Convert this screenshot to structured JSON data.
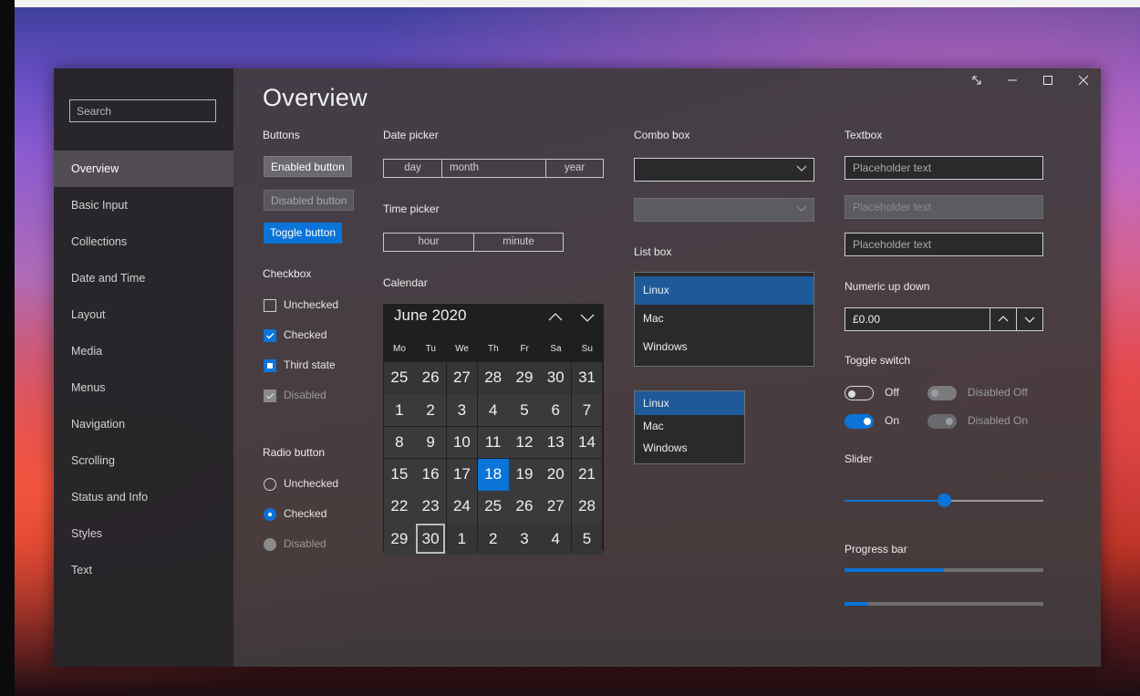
{
  "colors": {
    "accent": "#0a74d8",
    "window_bg": "#403c3e",
    "sidebar_bg": "#262428"
  },
  "search": {
    "placeholder": "Search"
  },
  "sidebar": {
    "items": [
      {
        "label": "Overview",
        "active": true
      },
      {
        "label": "Basic Input"
      },
      {
        "label": "Collections"
      },
      {
        "label": "Date and Time"
      },
      {
        "label": "Layout"
      },
      {
        "label": "Media"
      },
      {
        "label": "Menus"
      },
      {
        "label": "Navigation"
      },
      {
        "label": "Scrolling"
      },
      {
        "label": "Status and Info"
      },
      {
        "label": "Styles"
      },
      {
        "label": "Text"
      }
    ]
  },
  "titlebar": {
    "icons": [
      "resize-icon",
      "minimize-icon",
      "maximize-icon",
      "close-icon"
    ]
  },
  "page": {
    "title": "Overview"
  },
  "buttons": {
    "heading": "Buttons",
    "enabled": "Enabled button",
    "disabled": "Disabled button",
    "toggle": "Toggle button"
  },
  "checkbox": {
    "heading": "Checkbox",
    "unchecked": "Unchecked",
    "checked": "Checked",
    "third": "Third state",
    "disabled": "Disabled"
  },
  "radio": {
    "heading": "Radio button",
    "unchecked": "Unchecked",
    "checked": "Checked",
    "disabled": "Disabled"
  },
  "datepicker": {
    "heading": "Date picker",
    "day": "day",
    "month": "month",
    "year": "year"
  },
  "timepicker": {
    "heading": "Time picker",
    "hour": "hour",
    "minute": "minute"
  },
  "calendar": {
    "heading": "Calendar",
    "month_label": "June 2020",
    "weekdays": [
      "Mo",
      "Tu",
      "We",
      "Th",
      "Fr",
      "Sa",
      "Su"
    ],
    "days": [
      "25",
      "26",
      "27",
      "28",
      "29",
      "30",
      "31",
      "1",
      "2",
      "3",
      "4",
      "5",
      "6",
      "7",
      "8",
      "9",
      "10",
      "11",
      "12",
      "13",
      "14",
      "15",
      "16",
      "17",
      "18",
      "19",
      "20",
      "21",
      "22",
      "23",
      "24",
      "25",
      "26",
      "27",
      "28",
      "29",
      "30",
      "1",
      "2",
      "3",
      "4",
      "5"
    ],
    "selected": "18",
    "today": "30"
  },
  "combobox": {
    "heading": "Combo box"
  },
  "listbox": {
    "heading": "List box",
    "items": [
      "Linux",
      "Mac",
      "Windows"
    ],
    "items2": [
      "Linux",
      "Mac",
      "Windows"
    ],
    "selected": "Linux"
  },
  "textbox": {
    "heading": "Textbox",
    "placeholder1": "Placeholder text",
    "placeholder2": "Placeholder text",
    "placeholder3": "Placeholder text"
  },
  "numeric": {
    "heading": "Numeric up down",
    "value": "£0.00"
  },
  "toggle": {
    "heading": "Toggle switch",
    "off": "Off",
    "on": "On",
    "disabled_off": "Disabled Off",
    "disabled_on": "Disabled On"
  },
  "slider": {
    "heading": "Slider",
    "value_fraction": 0.5
  },
  "progress": {
    "heading": "Progress bar",
    "values": [
      0.5,
      0.12
    ]
  }
}
